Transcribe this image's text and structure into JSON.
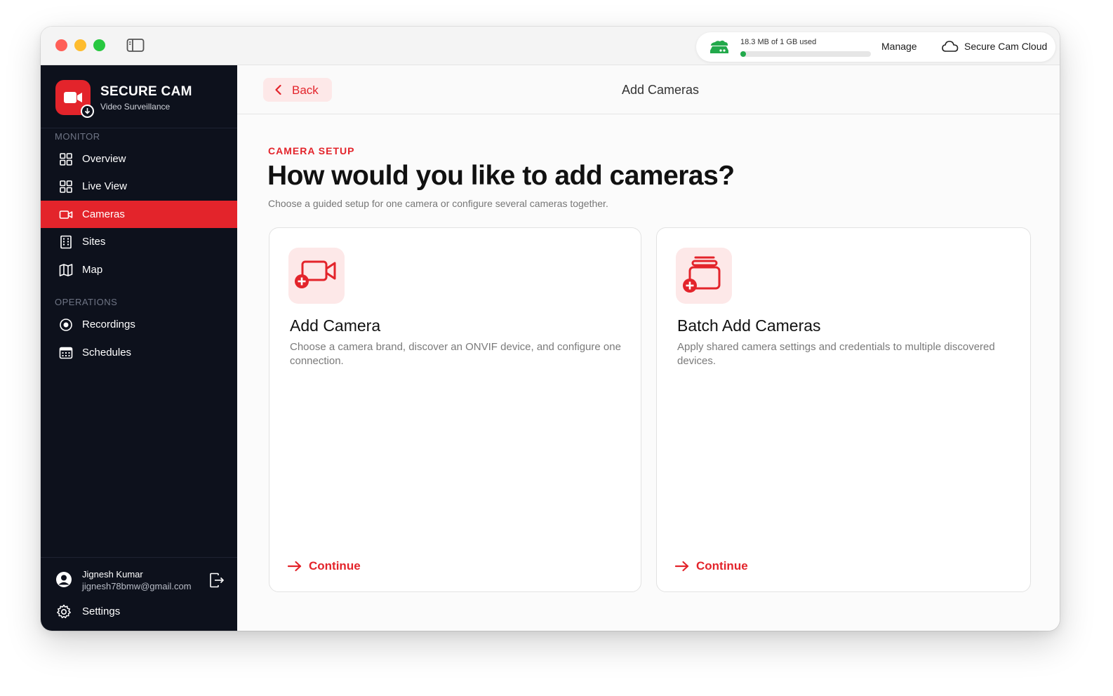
{
  "titlebar": {
    "storage_text": "18.3 MB of 1 GB used",
    "storage_used_fraction": 0.018,
    "manage_label": "Manage",
    "cloud_label": "Secure Cam Cloud"
  },
  "sidebar": {
    "brand_name": "SECURE CAM",
    "brand_sub": "Video Surveillance",
    "section_monitor": "MONITOR",
    "section_operations": "OPERATIONS",
    "items": [
      {
        "label": "Overview",
        "icon": "grid-icon"
      },
      {
        "label": "Live View",
        "icon": "grid-icon"
      },
      {
        "label": "Cameras",
        "icon": "video-camera-icon",
        "active": true
      },
      {
        "label": "Sites",
        "icon": "building-icon"
      },
      {
        "label": "Map",
        "icon": "map-icon"
      },
      {
        "label": "Recordings",
        "icon": "record-icon"
      },
      {
        "label": "Schedules",
        "icon": "calendar-icon"
      }
    ],
    "user_name": "Jignesh Kumar",
    "user_email": "jignesh78bmw@gmail.com",
    "settings_label": "Settings"
  },
  "header": {
    "back_label": "Back",
    "title": "Add Cameras"
  },
  "content": {
    "eyebrow": "CAMERA SETUP",
    "headline": "How would you like to add cameras?",
    "subhead": "Choose a guided setup for one camera or configure several cameras together.",
    "cards": [
      {
        "title": "Add Camera",
        "description": "Choose a camera brand, discover an ONVIF device, and configure one connection.",
        "cta": "Continue",
        "icon": "add-camera-icon"
      },
      {
        "title": "Batch Add Cameras",
        "description": "Apply shared camera settings and credentials to multiple discovered devices.",
        "cta": "Continue",
        "icon": "batch-add-icon"
      }
    ]
  },
  "colors": {
    "accent": "#e3242b",
    "sidebar_bg": "#0d111c",
    "storage_green": "#22a94b"
  }
}
